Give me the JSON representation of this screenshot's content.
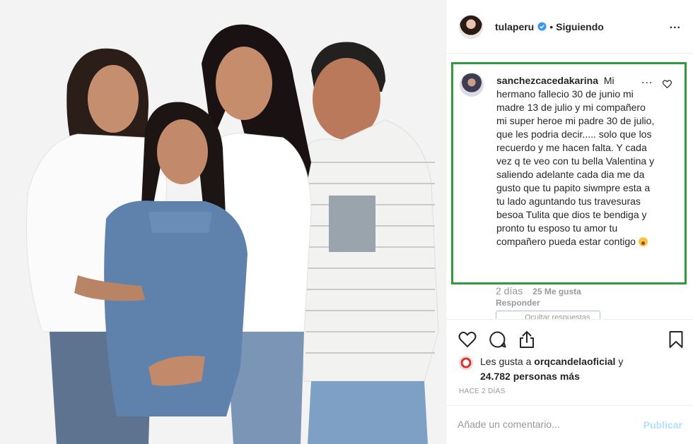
{
  "header": {
    "username": "tulaperu",
    "separator": "•",
    "follow_status": "Siguiendo",
    "more": "..."
  },
  "comment": {
    "username": "sanchezcacedakarina",
    "text": "Mi hermano fallecio 30 de junio mi madre 13 de julio y mi compañero mi super heroe mi padre 30 de julio, que les podria decir..... solo que los recuerdo y me hacen falta. Y cada vez q te veo con tu bella Valentina y saliendo adelante cada dia me da gusto que tu papito siwmpre esta a tu lado aguntando tus travesuras besoa Tulita que dios te bendiga y pronto tu esposo tu amor tu compañero pueda estar contigo",
    "more": "...",
    "time": "2 días",
    "likes": "25 Me gusta",
    "reply": "Responder",
    "hide_replies": "Ocultar respuestas"
  },
  "likes": {
    "prefix": "Les gusta a",
    "account": "orqcandelaoficial",
    "connector": "y",
    "others": "24.782 personas más"
  },
  "post_time": "HACE 2 DÍAS",
  "add_comment": {
    "placeholder": "Añade un comentario...",
    "publish": "Publicar"
  },
  "colors": {
    "highlight_border": "#2d9b3e",
    "verified": "#3897f0",
    "publish_disabled": "#b2dffc"
  },
  "icons": [
    "verified-icon",
    "more-icon",
    "heart-icon",
    "comment-icon",
    "share-icon",
    "bookmark-icon",
    "emoji-astonished-icon"
  ]
}
